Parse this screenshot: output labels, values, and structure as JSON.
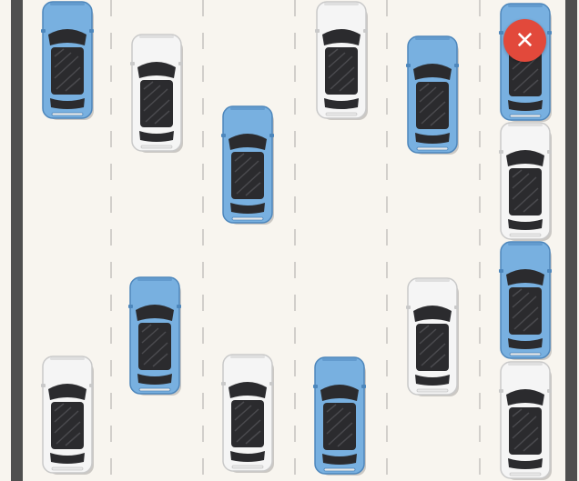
{
  "game": {
    "kind": "traffic-lanes",
    "lanes": 6,
    "colors": {
      "road": "#f8f5ef",
      "curb": "#4f4f4f",
      "lane_marking": "#d2cfcb",
      "car_blue": "#78b0e0",
      "car_white": "#f5f5f5",
      "close_button": "#e2493b"
    },
    "cars": [
      {
        "color": "blue",
        "lane": 1
      },
      {
        "color": "white",
        "lane": 2
      },
      {
        "color": "blue",
        "lane": 3
      },
      {
        "color": "white",
        "lane": 4
      },
      {
        "color": "blue",
        "lane": 5
      },
      {
        "color": "blue",
        "lane": 6
      },
      {
        "color": "white",
        "lane": 6
      },
      {
        "color": "blue",
        "lane": 2
      },
      {
        "color": "white",
        "lane": 5
      },
      {
        "color": "blue",
        "lane": 6
      },
      {
        "color": "white",
        "lane": 1
      },
      {
        "color": "white",
        "lane": 3
      },
      {
        "color": "blue",
        "lane": 4
      },
      {
        "color": "white",
        "lane": 6
      }
    ]
  },
  "close_button": {
    "icon": "close-icon",
    "glyph": "✕"
  }
}
